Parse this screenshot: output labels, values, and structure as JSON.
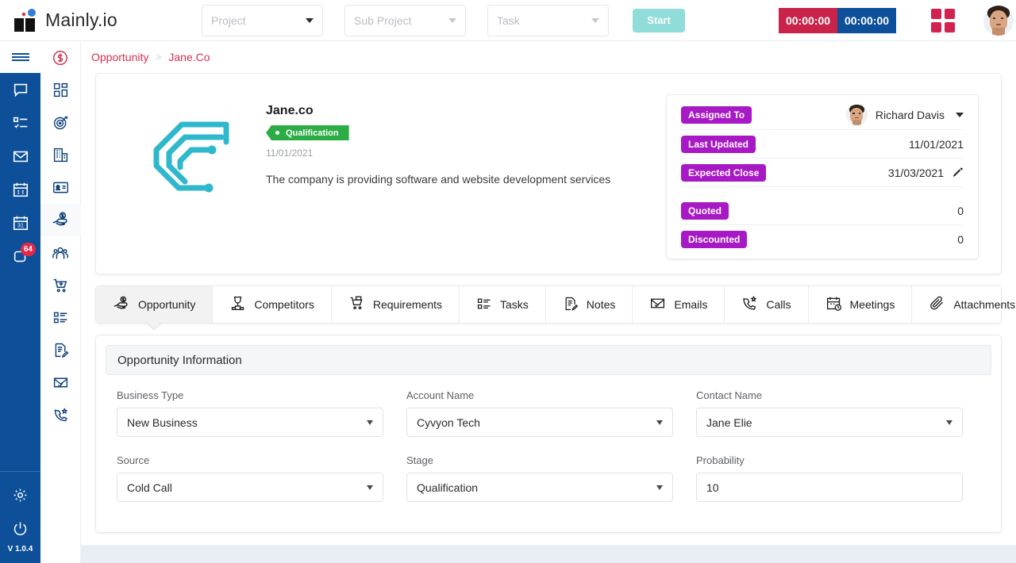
{
  "header": {
    "brand": "Mainly.io",
    "project_select": {
      "placeholder": "Project",
      "value": ""
    },
    "subproject_select": {
      "placeholder": "Sub Project",
      "value": ""
    },
    "task_select": {
      "placeholder": "Task",
      "value": ""
    },
    "start_button": "Start",
    "timer_red": "00:00:00",
    "timer_blue": "00:00:00",
    "grid_icon": "apps-grid-icon",
    "avatar": "user-avatar"
  },
  "sidebar_blue": {
    "menu_icon": "hamburger-menu-icon",
    "items": [
      {
        "name": "chat-icon",
        "label": "Chat"
      },
      {
        "name": "tasklist-icon",
        "label": "Task List"
      },
      {
        "name": "mail-icon",
        "label": "Mail"
      },
      {
        "name": "calendar-icon",
        "label": "Calendar"
      },
      {
        "name": "calendar-31-icon",
        "label": "Calendar 31"
      },
      {
        "name": "notes-icon",
        "label": "Notifications",
        "badge": "64"
      }
    ],
    "settings_icon": "gear-icon",
    "power_icon": "power-icon",
    "version": "V 1.0.4"
  },
  "sidebar_white": {
    "items": [
      {
        "name": "dashboard-icon",
        "label": "Dashboard"
      },
      {
        "name": "target-icon",
        "label": "Leads"
      },
      {
        "name": "building-icon",
        "label": "Accounts"
      },
      {
        "name": "contact-card-icon",
        "label": "Contacts"
      },
      {
        "name": "opportunity-hand-icon",
        "label": "Opportunity",
        "active": true
      },
      {
        "name": "people-group-icon",
        "label": "Teams"
      },
      {
        "name": "cart-icon",
        "label": "Products"
      },
      {
        "name": "list-icon",
        "label": "Quotes"
      },
      {
        "name": "note-edit-icon",
        "label": "Notes"
      },
      {
        "name": "mail-check-icon",
        "label": "Emails"
      },
      {
        "name": "phone-star-icon",
        "label": "Calls"
      }
    ]
  },
  "breadcrumb": {
    "parent": "Opportunity",
    "separator": ">",
    "current": "Jane.Co"
  },
  "profile": {
    "logo": "cyvyon-c-logo",
    "company": "Jane.co",
    "status_tag": "Qualification",
    "date": "11/01/2021",
    "description": "The company is providing software and website development services"
  },
  "info_panel": {
    "rows": [
      {
        "label": "Assigned To",
        "value": "Richard Davis",
        "has_avatar": true,
        "has_dropdown": true
      },
      {
        "label": "Last Updated",
        "value": "11/01/2021"
      },
      {
        "label": "Expected Close",
        "value": "31/03/2021",
        "has_edit": true
      },
      {
        "label": "Quoted",
        "value": "0"
      },
      {
        "label": "Discounted",
        "value": "0"
      }
    ]
  },
  "tabs": [
    {
      "label": "Opportunity",
      "icon": "opportunity-hand-icon",
      "active": true
    },
    {
      "label": "Competitors",
      "icon": "trophy-icon"
    },
    {
      "label": "Requirements",
      "icon": "cart-icon"
    },
    {
      "label": "Tasks",
      "icon": "list-icon"
    },
    {
      "label": "Notes",
      "icon": "note-edit-icon"
    },
    {
      "label": "Emails",
      "icon": "mail-check-icon"
    },
    {
      "label": "Calls",
      "icon": "phone-star-icon"
    },
    {
      "label": "Meetings",
      "icon": "calendar-clock-icon"
    },
    {
      "label": "Attachments",
      "icon": "paperclip-icon"
    }
  ],
  "form": {
    "section_title": "Opportunity Information",
    "fields": [
      {
        "label": "Business Type",
        "value": "New Business",
        "type": "select"
      },
      {
        "label": "Account Name",
        "value": "Cyvyon Tech",
        "type": "select"
      },
      {
        "label": "Contact Name",
        "value": "Jane Elie",
        "type": "select"
      },
      {
        "label": "Source",
        "value": "Cold Call",
        "type": "select"
      },
      {
        "label": "Stage",
        "value": "Qualification",
        "type": "select"
      },
      {
        "label": "Probability",
        "value": "10",
        "type": "text"
      }
    ]
  },
  "colors": {
    "brand_blue": "#0d5099",
    "crimson": "#c9234a",
    "purple_pill": "#a819c6",
    "green_tag": "#2bac45",
    "teal_logo": "#2fb8cc",
    "start_mint": "#8fdcd8"
  }
}
